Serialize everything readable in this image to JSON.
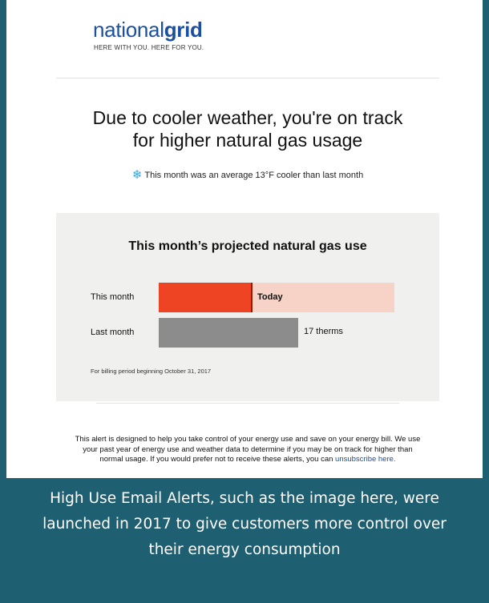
{
  "brand": {
    "name_regular": "national",
    "name_bold": "grid",
    "tagline": "HERE WITH YOU. HERE FOR YOU."
  },
  "headline": {
    "line1": "Due to cooler weather, you're on track",
    "line2": "for higher natural gas usage"
  },
  "weather_note": {
    "icon": "snowflake-icon",
    "text": "This month was an average 13°F cooler than last month"
  },
  "usage_panel": {
    "title": "This month’s projected natural gas use",
    "this_month": {
      "label": "This month",
      "marker_label": "Today",
      "progress_to_today_fraction": 0.4
    },
    "last_month": {
      "label": "Last month",
      "value": "17 therms",
      "fraction_of_scale": 0.59
    },
    "billing_note": "For billing period beginning October 31, 2017",
    "colors": {
      "this_month_fill": "#ef4423",
      "this_month_projection": "#f7d2c7",
      "last_month_fill": "#8c8c8c"
    }
  },
  "footer": {
    "text": "This alert is designed to help you take control of your energy use and save on your energy bill. We use your past year of energy use and weather data to determine if you may be on track for higher than normal usage. If you would prefer not to receive these alerts, you can",
    "link": "unsubscribe here."
  },
  "caption": {
    "line1": "High Use Email Alerts, such as the image here, were",
    "line2": "launched in 2017 to give customers more control over",
    "line3": "their energy consumption"
  },
  "colors": {
    "caption_background": "#1f5f72",
    "brand_blue": "#1b4fa0"
  }
}
